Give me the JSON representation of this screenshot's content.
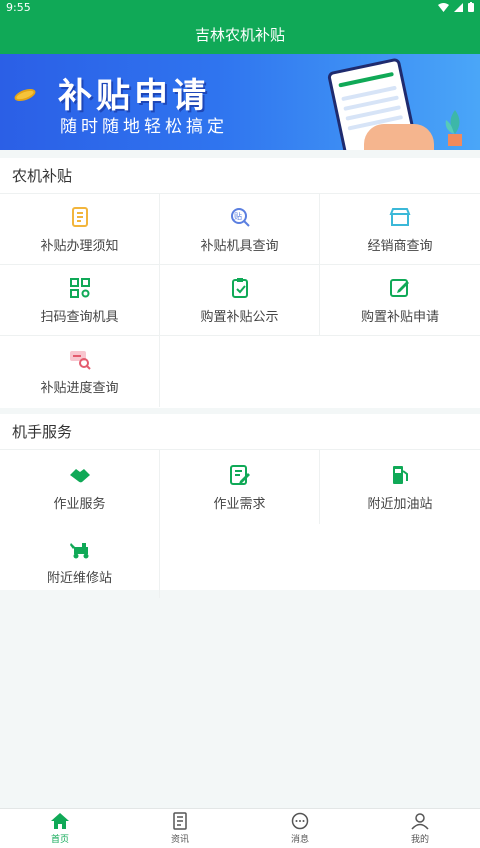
{
  "status_bar": {
    "time": "9:55"
  },
  "header": {
    "title": "吉林农机补贴"
  },
  "banner": {
    "headline": "补贴申请",
    "subline": "随时随地轻松搞定"
  },
  "subsidy_section": {
    "title": "农机补贴",
    "items": [
      {
        "label": "补贴办理须知",
        "icon": "document-icon",
        "color": "#f2b53c"
      },
      {
        "label": "补贴机具查询",
        "icon": "search-subsidy-icon",
        "color": "#5b7fe0"
      },
      {
        "label": "经销商查询",
        "icon": "store-icon",
        "color": "#3bb8d8"
      },
      {
        "label": "扫码查询机具",
        "icon": "qr-scan-icon",
        "color": "#10a957"
      },
      {
        "label": "购置补贴公示",
        "icon": "clipboard-icon",
        "color": "#10a957"
      },
      {
        "label": "购置补贴申请",
        "icon": "edit-icon",
        "color": "#10a957"
      },
      {
        "label": "补贴进度查询",
        "icon": "progress-search-icon",
        "color": "#e45b6e"
      }
    ]
  },
  "driver_section": {
    "title": "机手服务",
    "items": [
      {
        "label": "作业服务",
        "icon": "handshake-icon",
        "color": "#10a957"
      },
      {
        "label": "作业需求",
        "icon": "form-edit-icon",
        "color": "#10a957"
      },
      {
        "label": "附近加油站",
        "icon": "fuel-pump-icon",
        "color": "#10a957"
      },
      {
        "label": "附近维修站",
        "icon": "repair-vehicle-icon",
        "color": "#10a957"
      }
    ]
  },
  "tabbar": {
    "tabs": [
      {
        "label": "首页",
        "icon": "home-icon",
        "active": true
      },
      {
        "label": "资讯",
        "icon": "news-icon",
        "active": false
      },
      {
        "label": "消息",
        "icon": "message-icon",
        "active": false
      },
      {
        "label": "我的",
        "icon": "profile-icon",
        "active": false
      }
    ]
  }
}
